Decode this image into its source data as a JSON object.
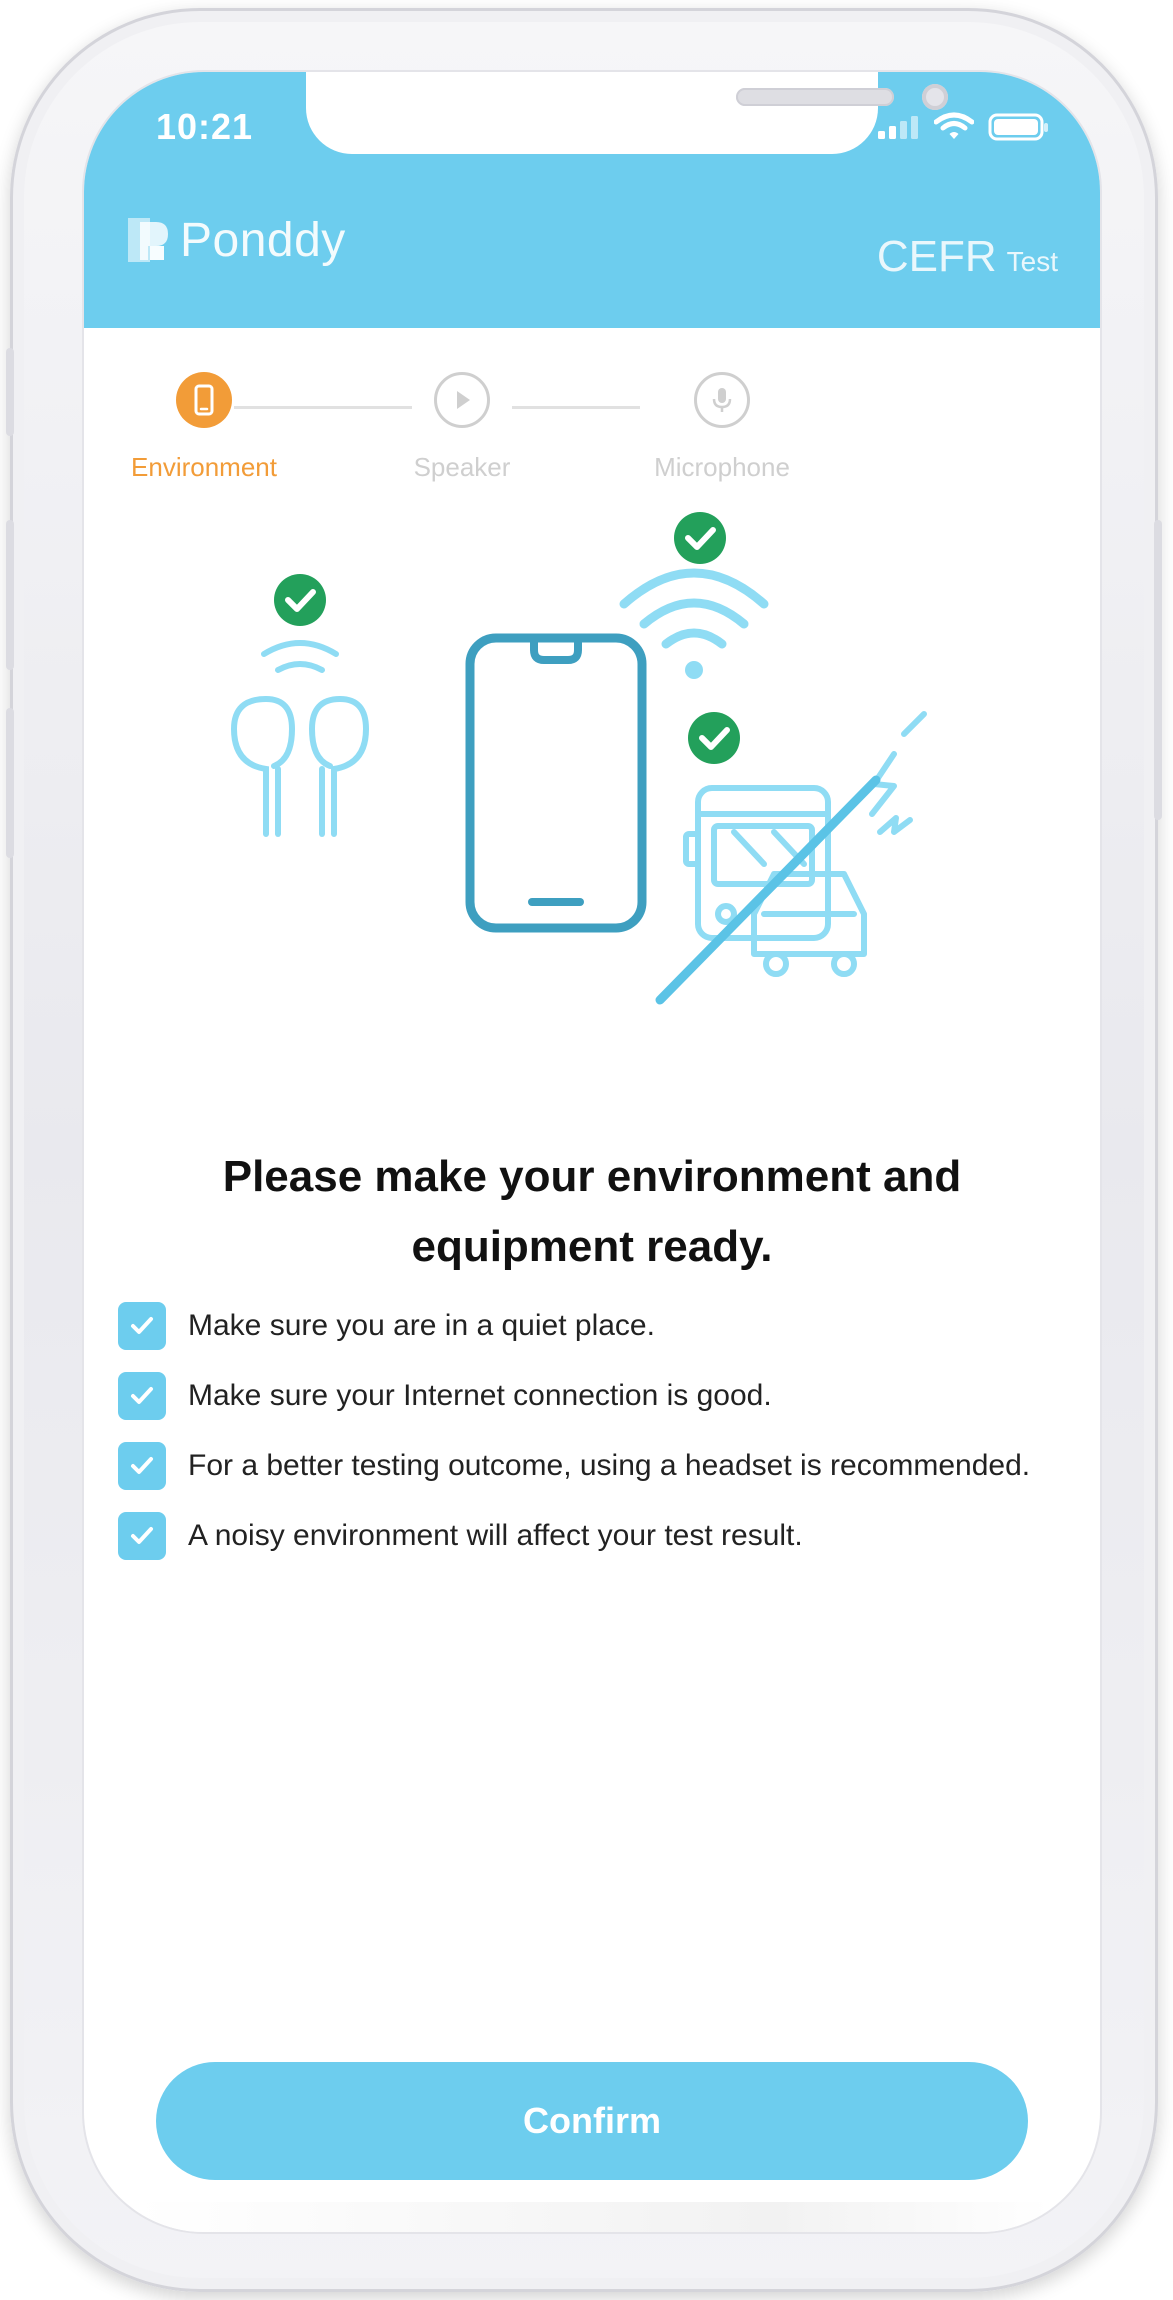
{
  "status_bar": {
    "time": "10:21",
    "icons": [
      "cellular-signal-icon",
      "wifi-icon",
      "battery-icon"
    ]
  },
  "header": {
    "brand": "Ponddy",
    "title_main": "CEFR",
    "title_sub": "Test",
    "background_color": "#6dcdee"
  },
  "stepper": {
    "steps": [
      {
        "label": "Environment",
        "icon": "phone-icon",
        "state": "active",
        "color": "#f29c38"
      },
      {
        "label": "Speaker",
        "icon": "play-icon",
        "state": "inactive",
        "color": "#cfcfcf"
      },
      {
        "label": "Microphone",
        "icon": "microphone-icon",
        "state": "inactive",
        "color": "#cfcfcf"
      }
    ]
  },
  "illustration": {
    "icons": [
      "earbuds-icon",
      "smartphone-icon",
      "wifi-icon",
      "no-traffic-noise-icon",
      "check-badge-icon"
    ],
    "check_color": "#23a05b"
  },
  "content": {
    "title": "Please make your environment and equipment ready.",
    "checklist": [
      "Make sure you are in a quiet place.",
      "Make sure your Internet connection is good.",
      "For a better testing outcome, using a headset is recommended.",
      "A noisy environment will affect your test result."
    ]
  },
  "footer": {
    "confirm_label": "Confirm"
  }
}
